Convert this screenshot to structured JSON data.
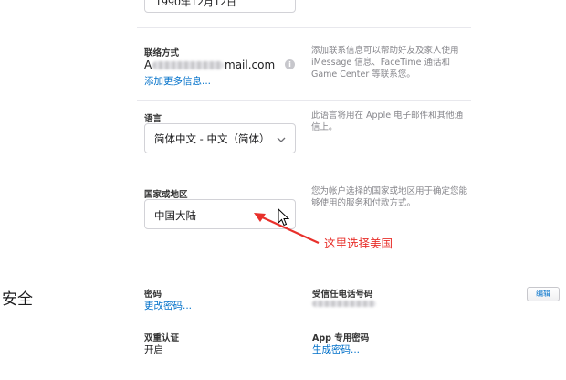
{
  "birthday": {
    "value": "1990年12月12日"
  },
  "contact": {
    "label": "联络方式",
    "email": "mail.com",
    "email_prefix": "A",
    "add_more": "添加更多信息...",
    "description": "添加联系信息可以帮助好友及家人使用 iMessage 信息、FaceTime 通话和 Game Center 等联系您。"
  },
  "language": {
    "label": "语言",
    "selected": "简体中文 - 中文（简体）",
    "description": "此语言将用在 Apple 电子邮件和其他通信上。"
  },
  "country": {
    "label": "国家或地区",
    "value": "中国大陆",
    "description": "您为帐户选择的国家或地区用于确定您能够使用的服务和付款方式。"
  },
  "annotation": {
    "text": "这里选择美国",
    "color": "#e8302b"
  },
  "security": {
    "title": "安全",
    "password_label": "密码",
    "password_link": "更改密码...",
    "trusted_phone_label": "受信任电话号码",
    "edit_button": "编辑",
    "two_factor_label": "双重认证",
    "two_factor_value": "开启",
    "app_password_label": "App 专用密码",
    "app_password_link": "生成密码..."
  }
}
